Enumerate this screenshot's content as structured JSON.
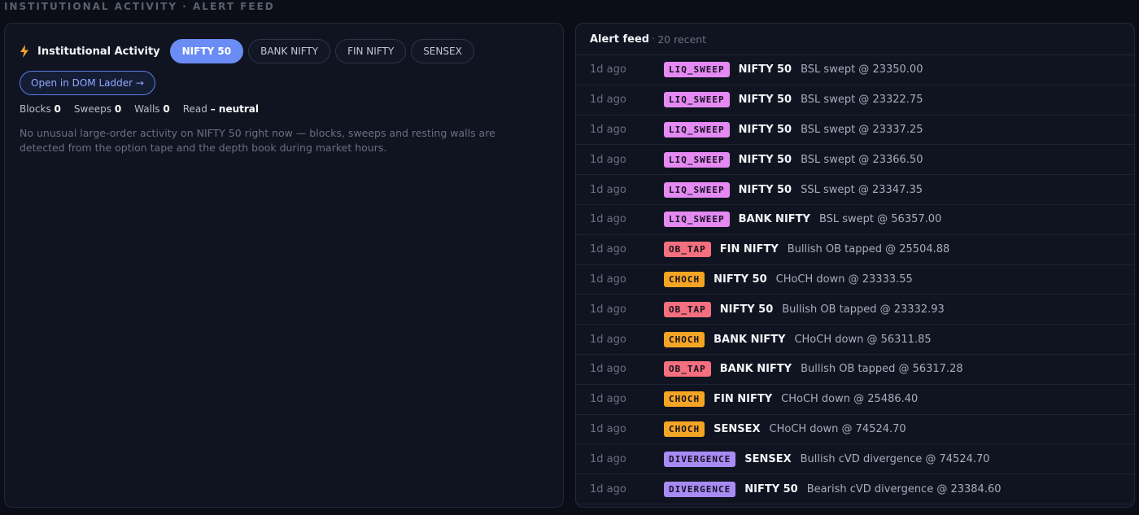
{
  "section_label": "INSTITUTIONAL ACTIVITY · ALERT FEED",
  "activity": {
    "title": "Institutional Activity",
    "tabs": [
      {
        "label": "NIFTY 50",
        "active": true
      },
      {
        "label": "BANK NIFTY",
        "active": false
      },
      {
        "label": "FIN NIFTY",
        "active": false
      },
      {
        "label": "SENSEX",
        "active": false
      }
    ],
    "dom_button": "Open in DOM Ladder →",
    "stats": {
      "blocks_label": "Blocks",
      "blocks_value": "0",
      "sweeps_label": "Sweeps",
      "sweeps_value": "0",
      "walls_label": "Walls",
      "walls_value": "0",
      "read_label": "Read",
      "read_value": "– neutral"
    },
    "empty_message": "No unusual large-order activity on NIFTY 50 right now — blocks, sweeps and resting walls are detected from the option tape and the depth book during market hours."
  },
  "feed": {
    "title": "Alert feed",
    "separator": "·",
    "count": "20 recent",
    "badge_colors": {
      "LIQ_SWEEP": "#e58af2",
      "OB_TAP": "#f4707e",
      "CHOCH": "#f5a524",
      "DIVERGENCE": "#a98bf5"
    },
    "rows": [
      {
        "time": "1d ago",
        "type": "LIQ_SWEEP",
        "symbol": "NIFTY 50",
        "message": "BSL swept @ 23350.00"
      },
      {
        "time": "1d ago",
        "type": "LIQ_SWEEP",
        "symbol": "NIFTY 50",
        "message": "BSL swept @ 23322.75"
      },
      {
        "time": "1d ago",
        "type": "LIQ_SWEEP",
        "symbol": "NIFTY 50",
        "message": "BSL swept @ 23337.25"
      },
      {
        "time": "1d ago",
        "type": "LIQ_SWEEP",
        "symbol": "NIFTY 50",
        "message": "BSL swept @ 23366.50"
      },
      {
        "time": "1d ago",
        "type": "LIQ_SWEEP",
        "symbol": "NIFTY 50",
        "message": "SSL swept @ 23347.35"
      },
      {
        "time": "1d ago",
        "type": "LIQ_SWEEP",
        "symbol": "BANK NIFTY",
        "message": "BSL swept @ 56357.00"
      },
      {
        "time": "1d ago",
        "type": "OB_TAP",
        "symbol": "FIN NIFTY",
        "message": "Bullish OB tapped @ 25504.88"
      },
      {
        "time": "1d ago",
        "type": "CHOCH",
        "symbol": "NIFTY 50",
        "message": "CHoCH down @ 23333.55"
      },
      {
        "time": "1d ago",
        "type": "OB_TAP",
        "symbol": "NIFTY 50",
        "message": "Bullish OB tapped @ 23332.93"
      },
      {
        "time": "1d ago",
        "type": "CHOCH",
        "symbol": "BANK NIFTY",
        "message": "CHoCH down @ 56311.85"
      },
      {
        "time": "1d ago",
        "type": "OB_TAP",
        "symbol": "BANK NIFTY",
        "message": "Bullish OB tapped @ 56317.28"
      },
      {
        "time": "1d ago",
        "type": "CHOCH",
        "symbol": "FIN NIFTY",
        "message": "CHoCH down @ 25486.40"
      },
      {
        "time": "1d ago",
        "type": "CHOCH",
        "symbol": "SENSEX",
        "message": "CHoCH down @ 74524.70"
      },
      {
        "time": "1d ago",
        "type": "DIVERGENCE",
        "symbol": "SENSEX",
        "message": "Bullish cVD divergence @ 74524.70"
      },
      {
        "time": "1d ago",
        "type": "DIVERGENCE",
        "symbol": "NIFTY 50",
        "message": "Bearish cVD divergence @ 23384.60"
      }
    ]
  }
}
